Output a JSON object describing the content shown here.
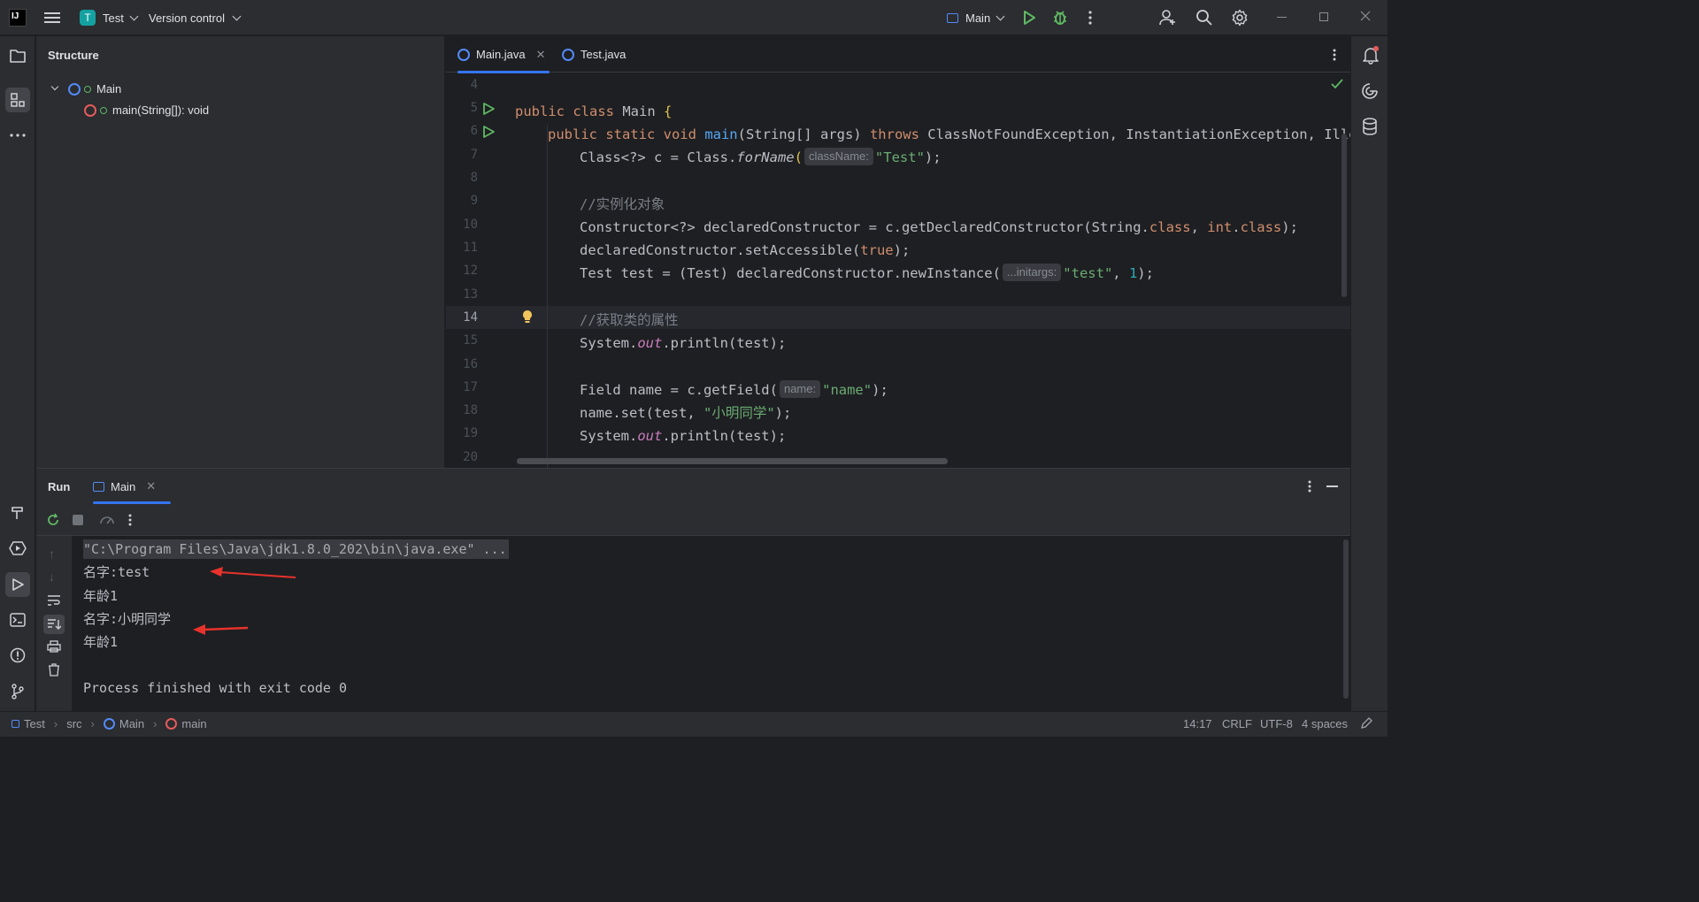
{
  "titlebar": {
    "logo": "IJ",
    "project_badge": "T",
    "project_name": "Test",
    "vcs_label": "Version control",
    "run_config": "Main"
  },
  "structure": {
    "title": "Structure",
    "tree": {
      "class_name": "Main",
      "method": "main(String[]): void"
    }
  },
  "editor": {
    "tabs": [
      {
        "label": "Main.java",
        "active": true
      },
      {
        "label": "Test.java",
        "active": false
      }
    ],
    "current_line": 14,
    "line_numbers": [
      "4",
      "5",
      "6",
      "7",
      "8",
      "9",
      "10",
      "11",
      "12",
      "13",
      "14",
      "15",
      "16",
      "17",
      "18",
      "19",
      "20"
    ],
    "hints": {
      "class_name": "className:",
      "initargs": "...initargs:",
      "name": "name:"
    },
    "code": {
      "l5": [
        "public class ",
        "Main ",
        "{"
      ],
      "l6": [
        "public static void ",
        "main",
        "(String[] args) ",
        "throws ",
        "ClassNotFoundException, InstantiationException, IllegalAccessException {"
      ],
      "l7": [
        "Class<?> c = Class.",
        "forName",
        "(",
        "\"Test\"",
        ");"
      ],
      "l9": "//实例化对象",
      "l10": [
        "Constructor<?> declaredConstructor = c.getDeclaredConstructor(String.",
        "class",
        ", ",
        "int",
        ".",
        "class",
        ");"
      ],
      "l11": [
        "declaredConstructor.setAccessible(",
        "true",
        ");"
      ],
      "l12": [
        "Test test = (Test) declaredConstructor.newInstance(",
        "\"test\"",
        ", ",
        "1",
        ");"
      ],
      "l14": "//获取类的属性",
      "l15": [
        "System.",
        "out",
        ".println(test);"
      ],
      "l17": [
        "Field name = c.getField(",
        "\"name\"",
        ");"
      ],
      "l18": [
        "name.set(test, ",
        "\"小明同学\"",
        ");"
      ],
      "l19": [
        "System.",
        "out",
        ".println(test);"
      ]
    }
  },
  "run": {
    "title": "Run",
    "tab_label": "Main",
    "console": [
      "\"C:\\Program Files\\Java\\jdk1.8.0_202\\bin\\java.exe\" ...",
      "名字:test",
      "年龄1",
      "名字:小明同学",
      "年龄1",
      "",
      "Process finished with exit code 0"
    ]
  },
  "statusbar": {
    "breadcrumbs": [
      "Test",
      "src",
      "Main",
      "main"
    ],
    "position": "14:17",
    "line_ending": "CRLF",
    "encoding": "UTF-8",
    "indent": "4 spaces"
  },
  "colors": {
    "accent": "#3574f0",
    "run_green": "#5fb865",
    "annotation_arrow": "#e8322b"
  }
}
